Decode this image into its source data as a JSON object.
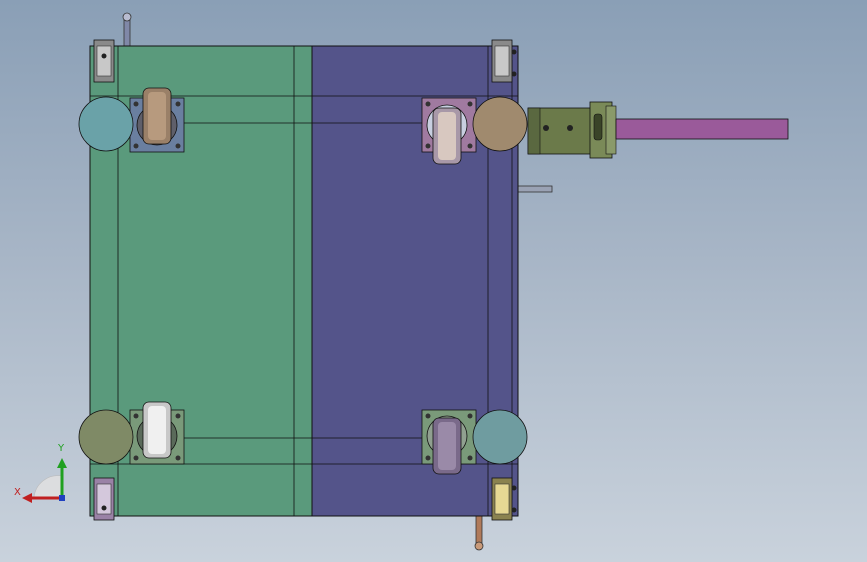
{
  "viewport": {
    "background": "#9aaabd"
  },
  "model": {
    "colors": {
      "green_panel": "#5a9a7c",
      "purple_panel": "#54548a",
      "outline": "#111111",
      "caster_plate_blue": "#6a7fa0",
      "caster_plate_pink": "#a07aa0",
      "caster_plate_green": "#7a9a7a",
      "wheel_tan": "#9a8068",
      "wheel_silver": "#d8d8d8",
      "wheel_purple": "#7a6a8a",
      "disc_teal": "#6aa2a8",
      "disc_olive": "#7f8a66",
      "disc_tan": "#a08a6e",
      "disc_blue_teal": "#6f9ca0",
      "handle_bar": "#9a5a9a",
      "handle_bracket": "#6b7a4a",
      "pin_blue": "#8088a8",
      "pin_copper": "#b07a5a",
      "bracket_gray": "#a0a0a0"
    }
  },
  "triad": {
    "x_label": "X",
    "y_label": "Y",
    "x_color": "#c02020",
    "y_color": "#20a020",
    "z_color": "#2040c0"
  }
}
